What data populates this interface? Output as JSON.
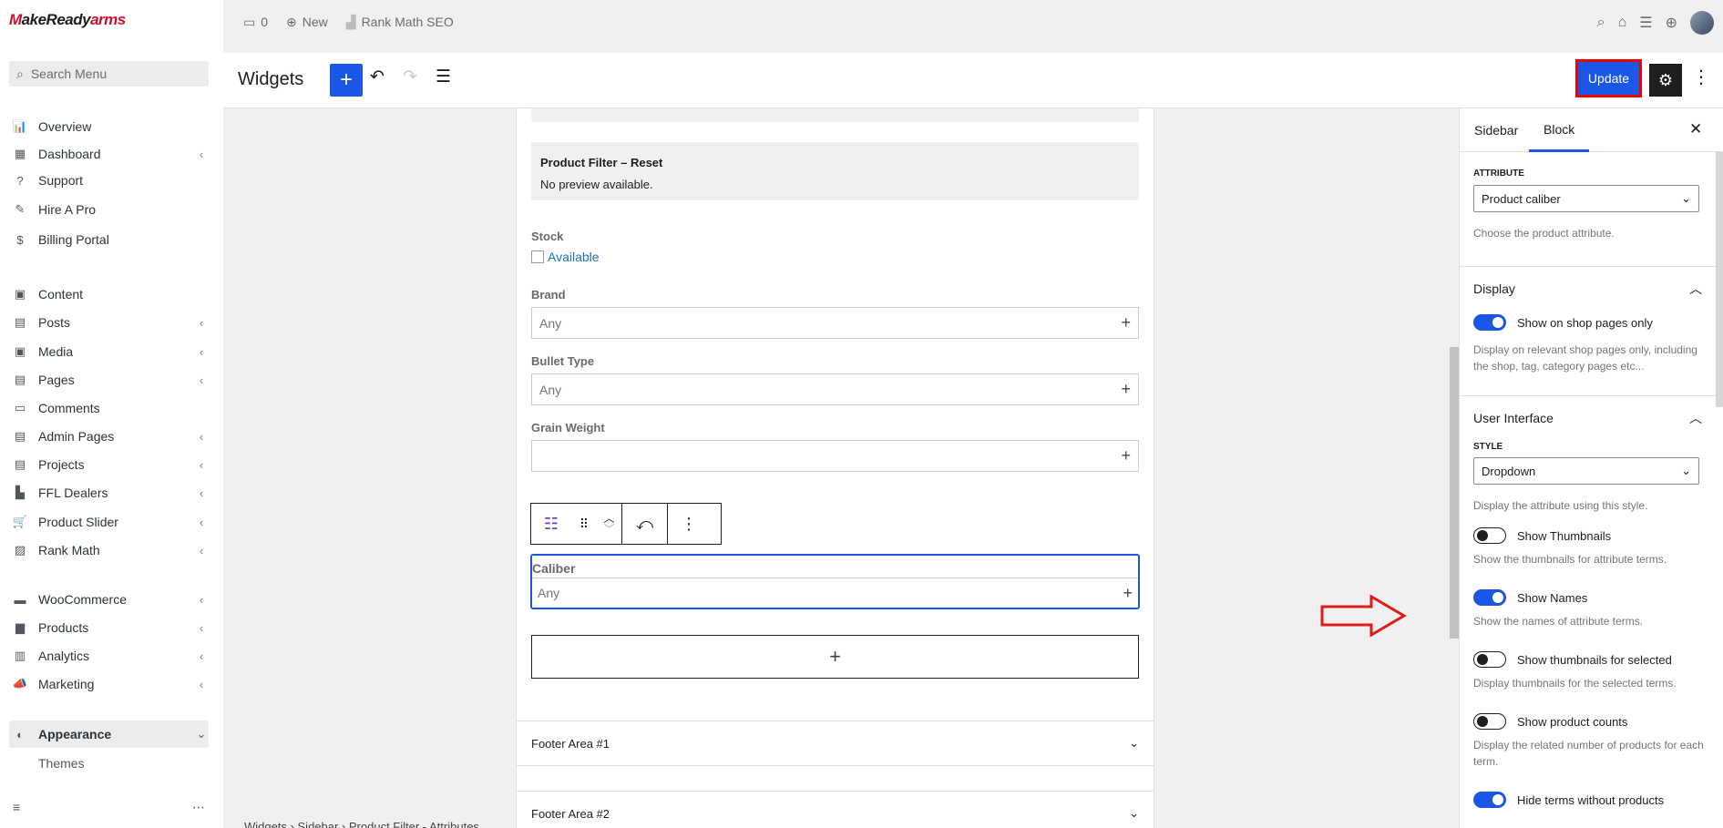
{
  "sidebar": {
    "logo_a": "M",
    "logo_b": "akeReady",
    "logo_c": "arms",
    "search_placeholder": "Search Menu",
    "items": [
      {
        "label": "Overview",
        "icon": "📊"
      },
      {
        "label": "Dashboard",
        "icon": "▦"
      },
      {
        "label": "Support",
        "icon": "?"
      },
      {
        "label": "Hire A Pro",
        "icon": "✎"
      },
      {
        "label": "Billing Portal",
        "icon": "$"
      },
      {
        "label": "Content",
        "icon": "▣"
      },
      {
        "label": "Posts",
        "icon": "▤"
      },
      {
        "label": "Media",
        "icon": "▣"
      },
      {
        "label": "Pages",
        "icon": "▤"
      },
      {
        "label": "Comments",
        "icon": "▭"
      },
      {
        "label": "Admin Pages",
        "icon": "▤"
      },
      {
        "label": "Projects",
        "icon": "▤"
      },
      {
        "label": "FFL Dealers",
        "icon": "▙"
      },
      {
        "label": "Product Slider",
        "icon": "🛒"
      },
      {
        "label": "Rank Math",
        "icon": "▨"
      },
      {
        "label": "WooCommerce",
        "icon": "▬"
      },
      {
        "label": "Products",
        "icon": "▆"
      },
      {
        "label": "Analytics",
        "icon": "▥"
      },
      {
        "label": "Marketing",
        "icon": "📣"
      },
      {
        "label": "Appearance",
        "icon": "◐"
      },
      {
        "label": "Themes",
        "icon": ""
      }
    ],
    "collapse_icon": "≡",
    "more_icon": "⋯"
  },
  "adminbar": {
    "comments_count": "0",
    "new_label": "New",
    "seo_label": "Rank Math SEO"
  },
  "header": {
    "title": "Widgets",
    "update_label": "Update"
  },
  "canvas": {
    "reset_title": "Product Filter – Reset",
    "reset_body": "No preview available.",
    "stock_label": "Stock",
    "stock_option": "Available",
    "fields": [
      {
        "label": "Brand",
        "value": "Any"
      },
      {
        "label": "Bullet Type",
        "value": "Any"
      },
      {
        "label": "Grain Weight",
        "value": ""
      }
    ],
    "caliber": {
      "label": "Caliber",
      "value": "Any"
    },
    "footers": [
      "Footer Area #1",
      "Footer Area #2"
    ],
    "breadcrumbs": "Widgets  ›  Sidebar  ›  Product Filter - Attributes"
  },
  "inspector": {
    "tab_sidebar": "Sidebar",
    "tab_block": "Block",
    "attribute_caption": "ATTRIBUTE",
    "attribute_value": "Product caliber",
    "attribute_help": "Choose the product attribute.",
    "display_title": "Display",
    "display_toggle": {
      "label": "Show on shop pages only",
      "on": true
    },
    "display_help": "Display on relevant shop pages only, including the shop, tag, category pages etc...",
    "ui_title": "User Interface",
    "style_caption": "STYLE",
    "style_value": "Dropdown",
    "style_help": "Display the attribute using this style.",
    "toggles": [
      {
        "label": "Show Thumbnails",
        "on": false,
        "help": "Show the thumbnails for attribute terms."
      },
      {
        "label": "Show Names",
        "on": true,
        "help": "Show the names of attribute terms."
      },
      {
        "label": "Show thumbnails for selected",
        "on": false,
        "help": "Display thumbnails for the selected terms."
      },
      {
        "label": "Show product counts",
        "on": false,
        "help": "Display the related number of products for each term."
      },
      {
        "label": "Hide terms without products",
        "on": true,
        "help": ""
      }
    ]
  }
}
